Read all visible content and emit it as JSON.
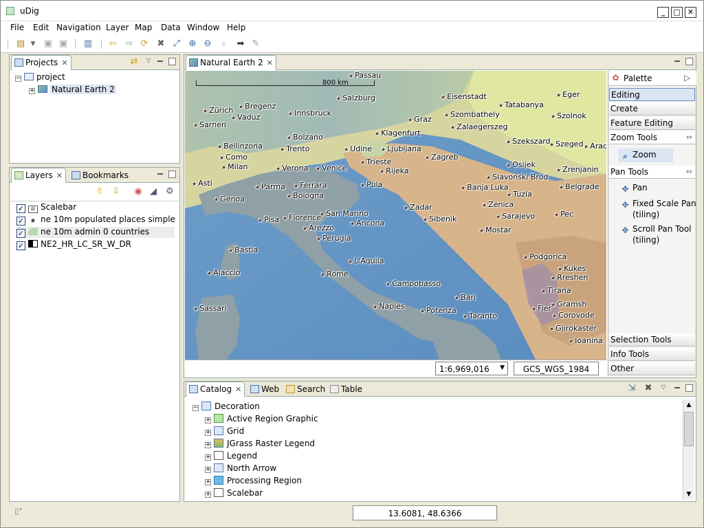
{
  "window": {
    "title": "uDig"
  },
  "menu": [
    "File",
    "Edit",
    "Navigation",
    "Layer",
    "Map",
    "Data",
    "Window",
    "Help"
  ],
  "projects": {
    "tab_label": "Projects",
    "root": "project",
    "child": "Natural Earth 2"
  },
  "layers": {
    "tab_label": "Layers",
    "bookmarks_label": "Bookmarks",
    "items": [
      {
        "label": "Scalebar",
        "checked": true,
        "icon": "scalebar-icon"
      },
      {
        "label": "ne 10m populated places simple",
        "checked": true,
        "icon": "star-icon"
      },
      {
        "label": "ne 10m admin 0 countries",
        "checked": true,
        "icon": "polygon-icon"
      },
      {
        "label": "NE2_HR_LC_SR_W_DR",
        "checked": true,
        "icon": "raster-icon"
      }
    ]
  },
  "map": {
    "tab_label": "Natural Earth 2",
    "scalebar_label": "800 km",
    "scale": "1:6,969,016",
    "crs": "GCS_WGS_1984",
    "cities": [
      {
        "name": "Passau"
      },
      {
        "name": "Salzburg"
      },
      {
        "name": "Eisenstadt"
      },
      {
        "name": "Eger"
      },
      {
        "name": "Bregenz"
      },
      {
        "name": "Zürich"
      },
      {
        "name": "Vaduz"
      },
      {
        "name": "Innsbruck"
      },
      {
        "name": "Graz"
      },
      {
        "name": "Szombathely"
      },
      {
        "name": "Tatabanya"
      },
      {
        "name": "Szolnok"
      },
      {
        "name": "Sarnen"
      },
      {
        "name": "Zalaegerszeg"
      },
      {
        "name": "Klagenfurt"
      },
      {
        "name": "Bellinzona"
      },
      {
        "name": "Bolzano"
      },
      {
        "name": "Szekszard"
      },
      {
        "name": "Szeged"
      },
      {
        "name": "Arad"
      },
      {
        "name": "Trento"
      },
      {
        "name": "Udine"
      },
      {
        "name": "Ljubljana"
      },
      {
        "name": "Como"
      },
      {
        "name": "Trieste"
      },
      {
        "name": "Zagreb"
      },
      {
        "name": "Milan"
      },
      {
        "name": "Verona"
      },
      {
        "name": "Venice"
      },
      {
        "name": "Rijeka"
      },
      {
        "name": "Osijek"
      },
      {
        "name": "Zrenjanin"
      },
      {
        "name": "Slavonski Brod"
      },
      {
        "name": "Asti"
      },
      {
        "name": "Parma"
      },
      {
        "name": "Ferrara"
      },
      {
        "name": "Pula"
      },
      {
        "name": "Banja Luka"
      },
      {
        "name": "Belgrade"
      },
      {
        "name": "Tuzla"
      },
      {
        "name": "Genoa"
      },
      {
        "name": "Bologna"
      },
      {
        "name": "Zadar"
      },
      {
        "name": "Zenica"
      },
      {
        "name": "San Marino"
      },
      {
        "name": "Sarajevo"
      },
      {
        "name": "Pisa"
      },
      {
        "name": "Florence"
      },
      {
        "name": "Ancona"
      },
      {
        "name": "Sibenik"
      },
      {
        "name": "Pec"
      },
      {
        "name": "Arezzo"
      },
      {
        "name": "Mostar"
      },
      {
        "name": "Perugia"
      },
      {
        "name": "Bastia"
      },
      {
        "name": "Podgorica"
      },
      {
        "name": "L'Aquila"
      },
      {
        "name": "Kukes"
      },
      {
        "name": "Ajaccio"
      },
      {
        "name": "Rome"
      },
      {
        "name": "Rreshen"
      },
      {
        "name": "Campobasso"
      },
      {
        "name": "Tirana"
      },
      {
        "name": "Bari"
      },
      {
        "name": "Gramsh"
      },
      {
        "name": "Sassari"
      },
      {
        "name": "Naples"
      },
      {
        "name": "Fier"
      },
      {
        "name": "Potenza"
      },
      {
        "name": "Corovode"
      },
      {
        "name": "Taranto"
      },
      {
        "name": "Gjirokaster"
      },
      {
        "name": "Ioanina"
      }
    ]
  },
  "palette": {
    "title": "Palette",
    "sections": {
      "editing": "Editing",
      "create": "Create",
      "feature_editing": "Feature Editing",
      "zoom_tools": "Zoom Tools",
      "zoom": "Zoom",
      "pan_tools": "Pan Tools",
      "pan": "Pan",
      "fixed_scale_pan": "Fixed Scale Pan",
      "fixed_scale_pan_sub": "(tiling)",
      "scroll_pan": "Scroll Pan Tool",
      "scroll_pan_sub": "(tiling)",
      "selection_tools": "Selection Tools",
      "info_tools": "Info Tools",
      "other": "Other"
    }
  },
  "catalog": {
    "tabs": [
      "Catalog",
      "Web",
      "Search",
      "Table"
    ],
    "root": "Decoration",
    "items": [
      "Active Region Graphic",
      "Grid",
      "JGrass Raster Legend",
      "Legend",
      "North Arrow",
      "Processing Region",
      "Scalebar"
    ]
  },
  "status": {
    "coords": "13.6081, 48.6366"
  }
}
